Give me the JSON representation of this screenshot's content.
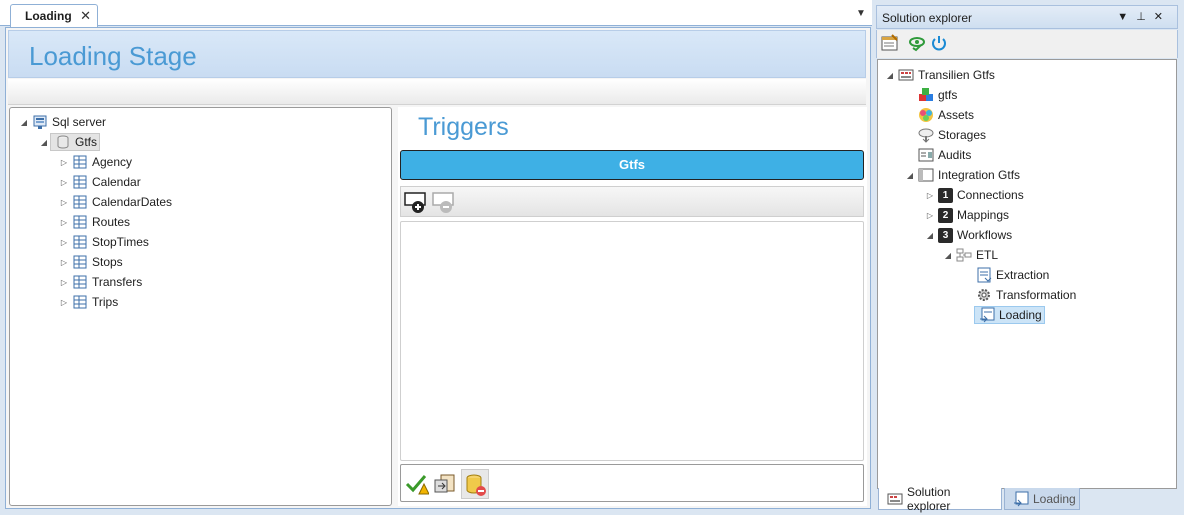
{
  "document": {
    "tab_label": "Loading",
    "stage_title": "Loading Stage",
    "sql_tree": {
      "root": "Sql server",
      "database": "Gtfs",
      "tables": [
        "Agency",
        "Calendar",
        "CalendarDates",
        "Routes",
        "StopTimes",
        "Stops",
        "Transfers",
        "Trips"
      ]
    },
    "triggers": {
      "title": "Triggers",
      "selected_target": "Gtfs"
    }
  },
  "solution_explorer": {
    "title": "Solution explorer",
    "tree": {
      "root": "Transilien Gtfs",
      "items": [
        "gtfs",
        "Assets",
        "Storages",
        "Audits"
      ],
      "integration": "Integration Gtfs",
      "steps": [
        {
          "num": "1",
          "label": "Connections"
        },
        {
          "num": "2",
          "label": "Mappings"
        },
        {
          "num": "3",
          "label": "Workflows"
        }
      ],
      "workflow": "ETL",
      "stages": [
        "Extraction",
        "Transformation",
        "Loading"
      ]
    },
    "bottom_tabs": [
      "Solution explorer",
      "Loading"
    ]
  },
  "colors": {
    "accent_blue": "#3eb0e5",
    "title_blue": "#4a9ad4",
    "selection": "#cce4f7"
  }
}
